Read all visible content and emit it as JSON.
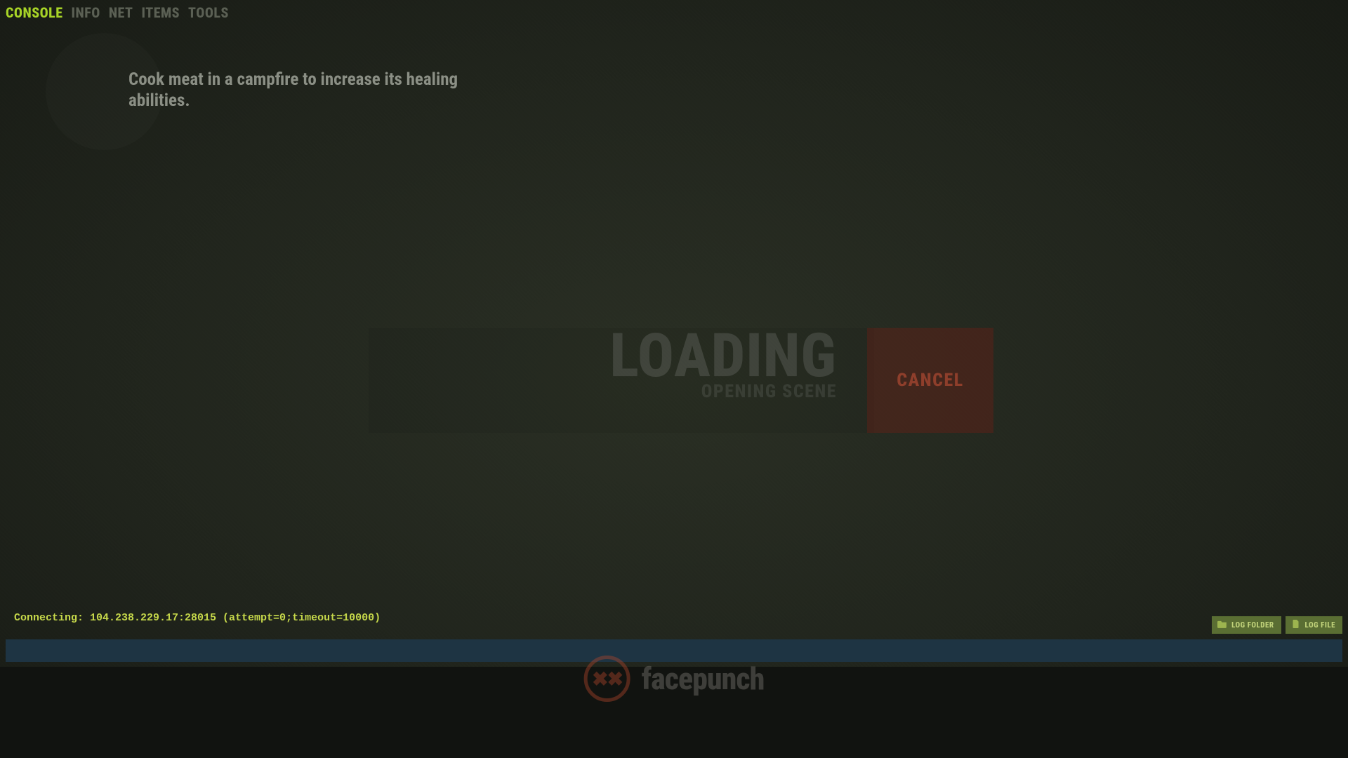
{
  "tabs": {
    "console": "CONSOLE",
    "info": "INFO",
    "net": "NET",
    "items": "ITEMS",
    "tools": "TOOLS"
  },
  "hint": {
    "text": "Cook meat in a campfire to increase its healing abilities."
  },
  "loading": {
    "title": "LOADING",
    "subtitle": "OPENING SCENE"
  },
  "cancel_label": "CANCEL",
  "console_log": "Connecting: 104.238.229.17:28015 (attempt=0;timeout=10000)",
  "log_buttons": {
    "folder": "LOG FOLDER",
    "file": "LOG FILE"
  },
  "brand": "facepunch",
  "brand_glyph": "✖✖"
}
